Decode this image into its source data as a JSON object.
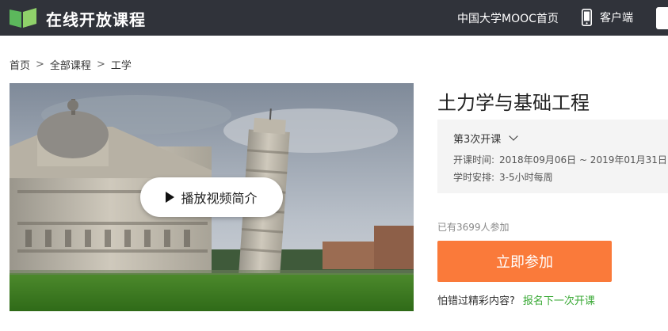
{
  "header": {
    "brand": "在线开放课程",
    "nav_link": "中国大学MOOC首页",
    "client_label": "客户端"
  },
  "breadcrumb": [
    "首页",
    "全部课程",
    "工学"
  ],
  "breadcrumb_separator": ">",
  "video": {
    "play_label": "播放视频简介"
  },
  "course": {
    "title": "土力学与基础工程",
    "term_label": "第3次开课",
    "schedule_key": "开课时间:",
    "schedule_value": "2018年09月06日 ~ 2019年01月31日",
    "hours_key": "学时安排:",
    "hours_value": "3-5小时每周",
    "enrolled": "已有3699人参加",
    "join_label": "立即参加",
    "missed_prompt": "怕错过精彩内容?",
    "next_term_link": "报名下一次开课"
  },
  "colors": {
    "topbar": "#30333a",
    "accent_orange": "#fa7a3a",
    "link_green": "#39a935",
    "logo_green": "#5cb85c"
  },
  "icons": [
    "book-logo-icon",
    "phone-icon",
    "play-icon",
    "chevron-down-icon"
  ]
}
